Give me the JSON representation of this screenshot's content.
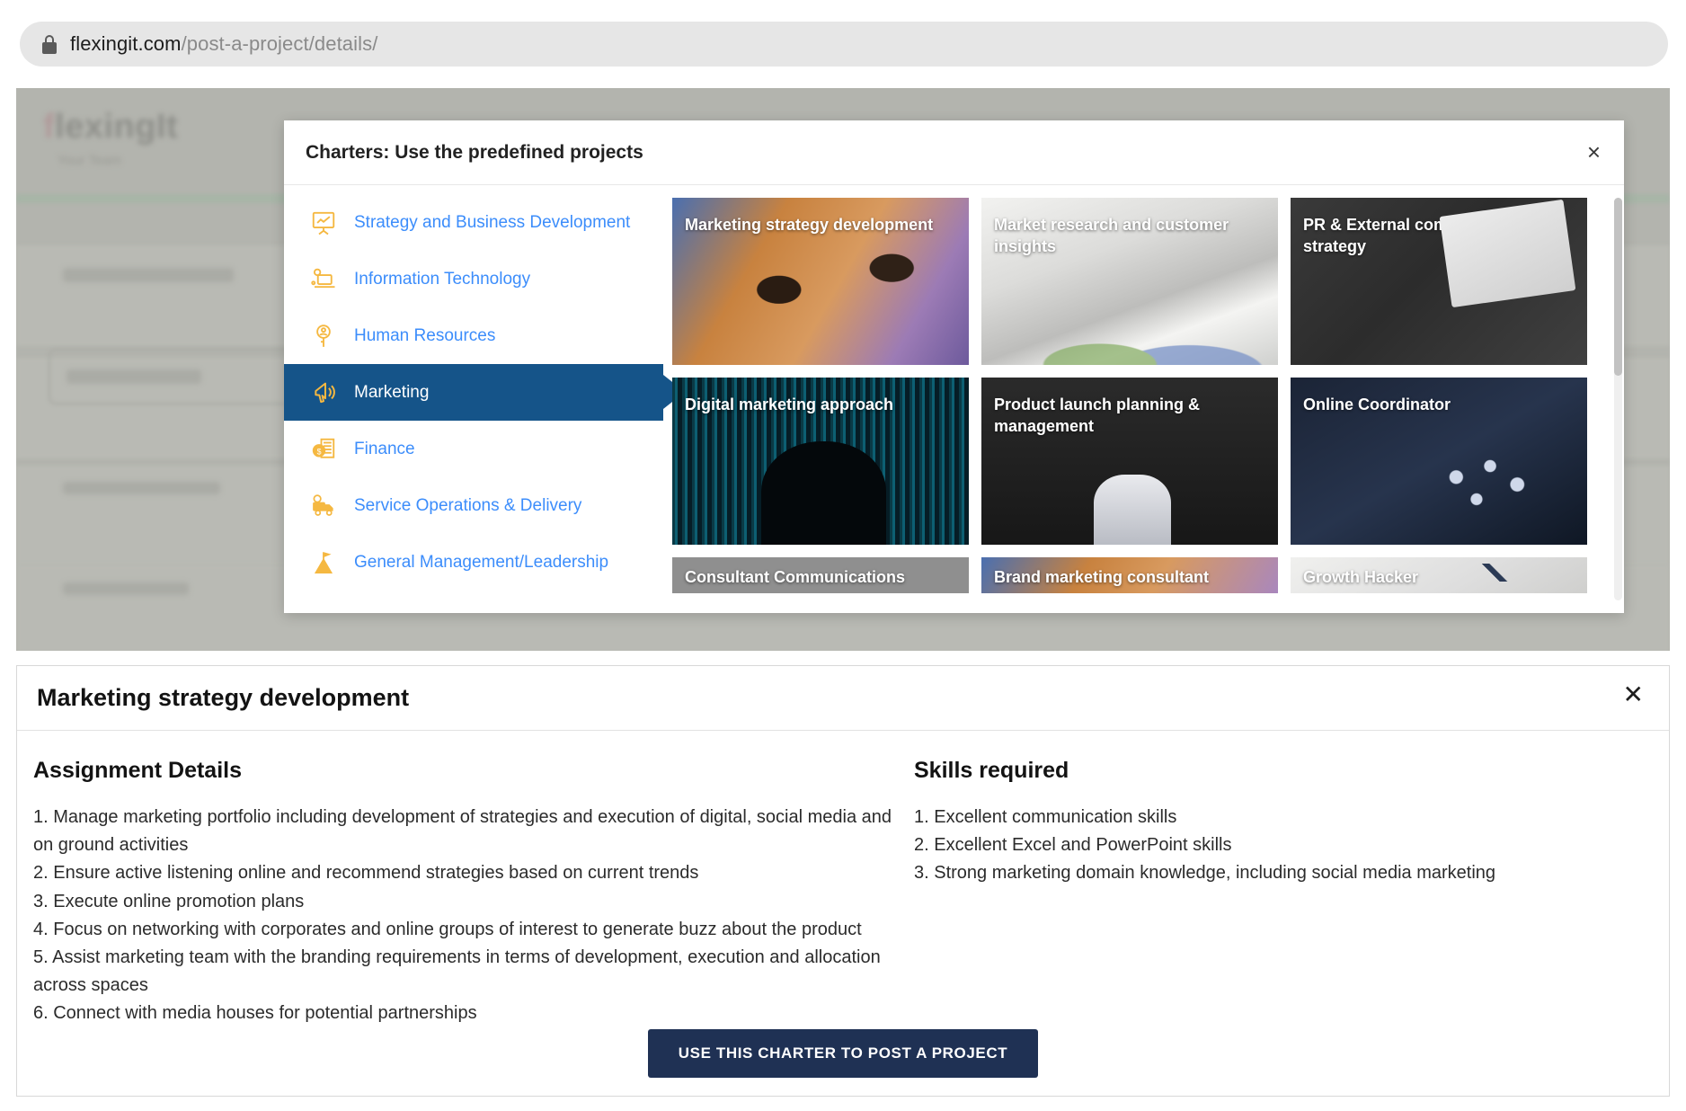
{
  "browser": {
    "lock_icon": "lock-icon",
    "url_domain": "flexingit.com",
    "url_path": "/post-a-project/details/"
  },
  "background_page": {
    "logo_text": "flexingIt",
    "logo_tagline": "Your Team"
  },
  "modal": {
    "title": "Charters: Use the predefined projects",
    "close_label": "×",
    "categories": [
      {
        "label": "Strategy and Business Development",
        "icon": "presentation-chart-icon",
        "selected": false
      },
      {
        "label": "Information Technology",
        "icon": "laptop-gear-icon",
        "selected": false
      },
      {
        "label": "Human Resources",
        "icon": "person-badge-icon",
        "selected": false
      },
      {
        "label": "Marketing",
        "icon": "megaphone-icon",
        "selected": true
      },
      {
        "label": "Finance",
        "icon": "coins-icon",
        "selected": false
      },
      {
        "label": "Service Operations & Delivery",
        "icon": "delivery-truck-icon",
        "selected": false
      },
      {
        "label": "General Management/Leadership",
        "icon": "flag-mountain-icon",
        "selected": false
      }
    ],
    "cards": [
      {
        "label": "Marketing strategy development",
        "thumb": "th-glasses"
      },
      {
        "label": "Market research and customer insights",
        "thumb": "th-papers"
      },
      {
        "label": "PR & External communications strategy",
        "thumb": "th-desk"
      },
      {
        "label": "Digital marketing approach",
        "thumb": "th-matrix"
      },
      {
        "label": "Product launch planning & management",
        "thumb": "th-launch"
      },
      {
        "label": "Online Coordinator",
        "thumb": "th-suit"
      },
      {
        "label": "Consultant Communications",
        "thumb": "th-gray"
      },
      {
        "label": "Brand marketing consultant",
        "thumb": "th-brand"
      },
      {
        "label": "Growth Hacker",
        "thumb": "th-growth"
      }
    ]
  },
  "detail": {
    "title": "Marketing strategy development",
    "close_label": "✕",
    "assignment_heading": "Assignment Details",
    "assignment_items": [
      "1. Manage marketing portfolio including development of strategies and execution of digital, social media and on ground activities",
      "2. Ensure active listening online and recommend strategies based on current trends",
      "3. Execute online promotion plans",
      "4. Focus on networking with corporates and online groups of interest to generate buzz about the product",
      "5. Assist marketing team with the branding requirements in terms of development, execution and allocation across spaces",
      "6. Connect with media houses for potential partnerships"
    ],
    "skills_heading": "Skills required",
    "skills_items": [
      "1. Excellent communication skills",
      "2. Excellent Excel and PowerPoint skills",
      "3. Strong marketing domain knowledge, including social media marketing"
    ],
    "cta_label": "USE THIS CHARTER TO POST A PROJECT"
  },
  "colors": {
    "accent_blue": "#155489",
    "link_blue": "#3c8dfb",
    "icon_orange": "#f5b841",
    "cta_navy": "#1f3154"
  }
}
